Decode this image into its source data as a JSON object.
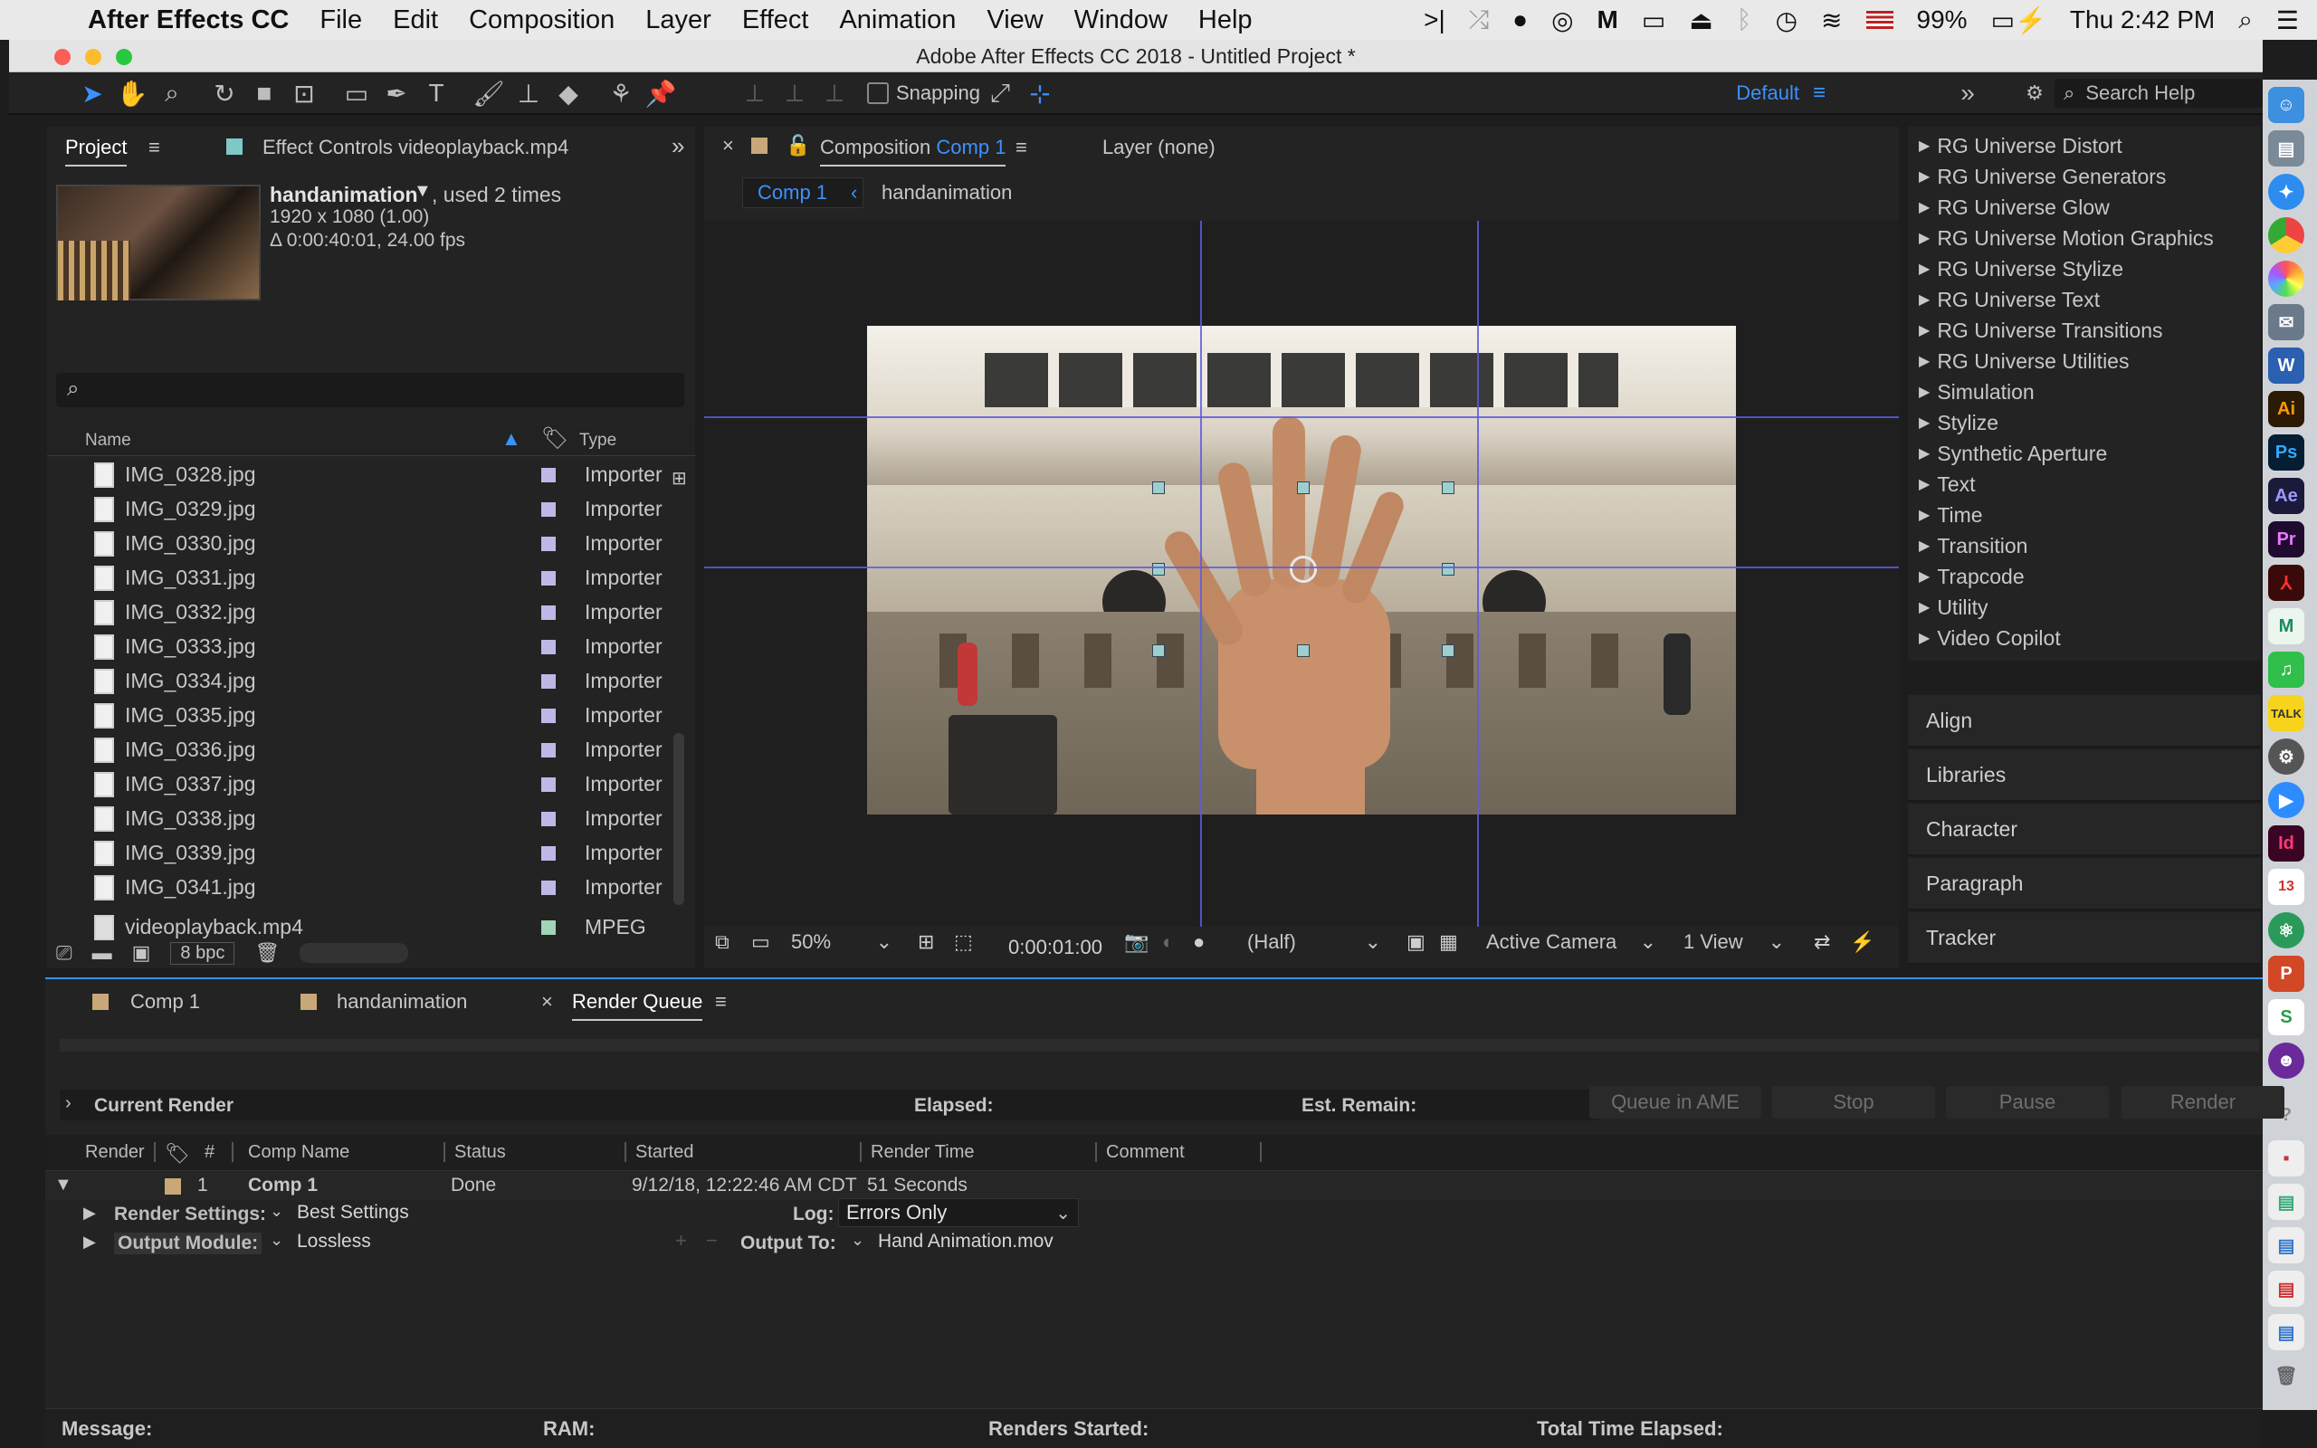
{
  "menubar": {
    "app": "After Effects CC",
    "items": [
      "File",
      "Edit",
      "Composition",
      "Layer",
      "Effect",
      "Animation",
      "View",
      "Window",
      "Help"
    ],
    "battery": "99%",
    "clock": "Thu 2:42 PM"
  },
  "window": {
    "title": "Adobe After Effects CC 2018 - Untitled Project *"
  },
  "toolbar": {
    "snapping_label": "Snapping",
    "workspace": "Default",
    "search_placeholder": "Search Help"
  },
  "project": {
    "tab_label": "Project",
    "effect_controls_tab": "Effect Controls videoplayback.mp4",
    "asset_name": "handanimation",
    "asset_used": ", used 2 times",
    "asset_dims": "1920 x 1080 (1.00)",
    "asset_duration": "Δ 0:00:40:01, 24.00 fps",
    "col_name": "Name",
    "col_type": "Type",
    "files": [
      {
        "name": "IMG_0328.jpg",
        "type": "Importer"
      },
      {
        "name": "IMG_0329.jpg",
        "type": "Importer"
      },
      {
        "name": "IMG_0330.jpg",
        "type": "Importer"
      },
      {
        "name": "IMG_0331.jpg",
        "type": "Importer"
      },
      {
        "name": "IMG_0332.jpg",
        "type": "Importer"
      },
      {
        "name": "IMG_0333.jpg",
        "type": "Importer"
      },
      {
        "name": "IMG_0334.jpg",
        "type": "Importer"
      },
      {
        "name": "IMG_0335.jpg",
        "type": "Importer"
      },
      {
        "name": "IMG_0336.jpg",
        "type": "Importer"
      },
      {
        "name": "IMG_0337.jpg",
        "type": "Importer"
      },
      {
        "name": "IMG_0338.jpg",
        "type": "Importer"
      },
      {
        "name": "IMG_0339.jpg",
        "type": "Importer"
      },
      {
        "name": "IMG_0341.jpg",
        "type": "Importer"
      },
      {
        "name": "videoplayback.mp4",
        "type": "MPEG"
      }
    ],
    "bpc": "8 bpc"
  },
  "composition": {
    "tab_prefix": "Composition",
    "tab_comp": "Comp 1",
    "layer_tab": "Layer (none)",
    "breadcrumb_comp": "Comp 1",
    "breadcrumb_layer": "handanimation",
    "zoom": "50%",
    "timecode": "0:00:01:00",
    "resolution": "(Half)",
    "camera": "Active Camera",
    "views": "1 View"
  },
  "effects": {
    "items": [
      "RG Universe Distort",
      "RG Universe Generators",
      "RG Universe Glow",
      "RG Universe Motion Graphics",
      "RG Universe Stylize",
      "RG Universe Text",
      "RG Universe Transitions",
      "RG Universe Utilities",
      "Simulation",
      "Stylize",
      "Synthetic Aperture",
      "Text",
      "Time",
      "Transition",
      "Trapcode",
      "Utility",
      "Video Copilot"
    ]
  },
  "panels": [
    "Align",
    "Libraries",
    "Character",
    "Paragraph",
    "Tracker"
  ],
  "bottom_tabs": [
    "Comp 1",
    "handanimation",
    "Render Queue"
  ],
  "render_queue": {
    "current_render": "Current Render",
    "elapsed": "Elapsed:",
    "est_remain": "Est. Remain:",
    "buttons": [
      "Queue in AME",
      "Stop",
      "Pause",
      "Render"
    ],
    "columns": [
      "Render",
      "#",
      "Comp Name",
      "Status",
      "Started",
      "Render Time",
      "Comment"
    ],
    "item": {
      "num": "1",
      "comp": "Comp 1",
      "status": "Done",
      "started": "9/12/18, 12:22:46 AM CDT",
      "render_time": "51 Seconds"
    },
    "render_settings_label": "Render Settings:",
    "render_settings_value": "Best Settings",
    "log_label": "Log:",
    "log_value": "Errors Only",
    "output_module_label": "Output Module:",
    "output_module_value": "Lossless",
    "output_to_label": "Output To:",
    "output_to_value": "Hand Animation.mov",
    "footer": {
      "message": "Message:",
      "ram": "RAM:",
      "renders_started": "Renders Started:",
      "total_time": "Total Time Elapsed:"
    }
  },
  "colors": {
    "accent": "#3b92ff",
    "panel": "#232323",
    "bg": "#1d1d1d"
  }
}
